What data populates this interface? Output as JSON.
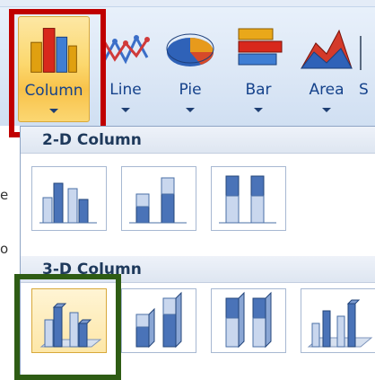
{
  "ribbon": {
    "buttons": [
      {
        "label": "Column",
        "icon": "column-chart-icon",
        "selected": true
      },
      {
        "label": "Line",
        "icon": "line-chart-icon"
      },
      {
        "label": "Pie",
        "icon": "pie-chart-icon"
      },
      {
        "label": "Bar",
        "icon": "bar-chart-icon"
      },
      {
        "label": "Area",
        "icon": "area-chart-icon"
      },
      {
        "label": "S",
        "icon": "scatter-chart-icon"
      }
    ]
  },
  "gallery": {
    "section_2d": "2-D Column",
    "section_3d": "3-D Column"
  },
  "edge_fragments": [
    "e",
    "o"
  ],
  "colors": {
    "accent_red": "#c00000",
    "accent_green": "#2e5c14",
    "ribbon_text": "#15428b",
    "selected_fill": "#fcd86e"
  }
}
